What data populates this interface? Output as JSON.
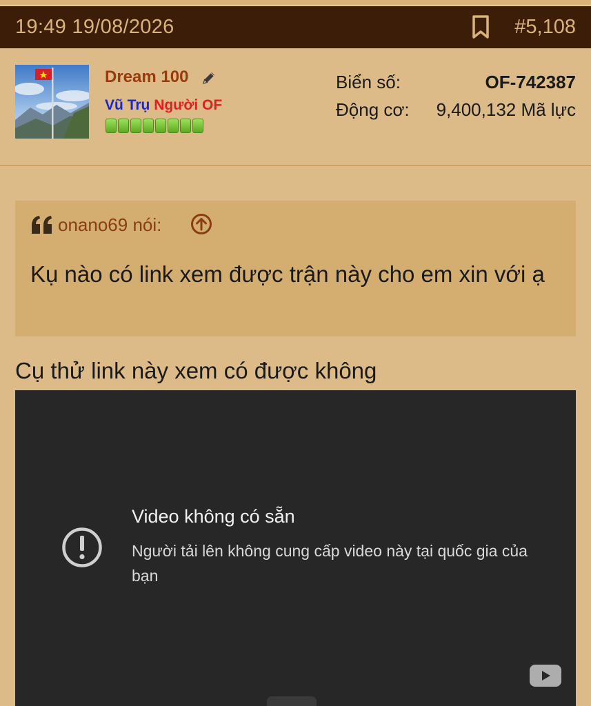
{
  "header": {
    "timestamp": "19:49 19/08/2026",
    "bookmark_icon": "bookmark-icon",
    "post_number": "#5,108"
  },
  "user": {
    "name": "Dream 100",
    "edit_icon": "pencil-icon",
    "title_part1": "Vũ Trụ",
    "title_part2": "Người OF",
    "rank_pips": 8,
    "colors": {
      "name": "#9a3b0e",
      "title_blue": "#1a27c9",
      "title_red": "#e31e1e"
    }
  },
  "stats": {
    "plate_label": "Biển số:",
    "plate_value": "OF-742387",
    "engine_label": "Động cơ:",
    "engine_value": "9,400,132 Mã lực"
  },
  "quote": {
    "author_line": "onano69 nói:",
    "text": "Kụ nào có link xem được trận này cho em xin với ạ"
  },
  "post": {
    "text": "Cụ thử link này xem có được không"
  },
  "video": {
    "title": "Video không có sẵn",
    "message": "Người tải lên không cung cấp video này tại quốc gia của bạn",
    "warning_icon": "exclamation-circle-icon",
    "logo_icon": "youtube-icon"
  },
  "colors": {
    "page_bg": "#dcbb88",
    "header_bg": "#3c1e08",
    "header_text": "#d9b37a",
    "quote_bg": "#d4ae71",
    "video_bg": "#272727"
  }
}
